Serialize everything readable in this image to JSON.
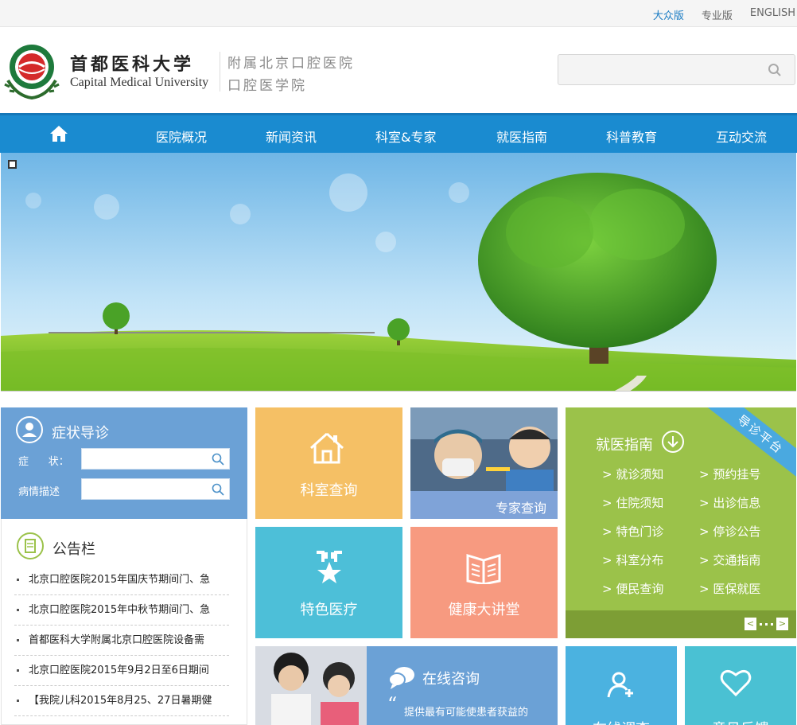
{
  "topbar": {
    "links": [
      "大众版",
      "专业版",
      "ENGLISH"
    ],
    "active_color": "#1a7cc4"
  },
  "header": {
    "brand_cn": "首都医科大学",
    "brand_en": "Capital Medical University",
    "sub_line1": "附属北京口腔医院",
    "sub_line2": "口腔医学院",
    "search_placeholder": ""
  },
  "nav": {
    "home_icon": "home-icon",
    "items": [
      "医院概况",
      "新闻资讯",
      "科室&专家",
      "就医指南",
      "科普教育",
      "互动交流"
    ],
    "color": "#1a8bd0"
  },
  "symptom": {
    "title": "症状导诊",
    "field1_label": "症      状：",
    "field2_label": "病情描述"
  },
  "notice": {
    "title": "公告栏",
    "items": [
      "北京口腔医院2015年国庆节期间门、急",
      "北京口腔医院2015年中秋节期间门、急",
      "首都医科大学附属北京口腔医院设备需",
      "北京口腔医院2015年9月2日至6日期间",
      "【我院儿科2015年8月25、27日暑期健"
    ]
  },
  "tiles": {
    "dept": "科室查询",
    "expert": "专家查询",
    "special": "特色医疗",
    "lecture": "健康大讲堂",
    "consult_title": "在线咨询",
    "consult_desc": "提供最有可能使患者获益的",
    "survey": "在线调查",
    "feedback": "意见反馈"
  },
  "guide": {
    "title": "就医指南",
    "ribbon": "导诊平台",
    "links": [
      "> 就诊须知",
      "> 预约挂号",
      "> 住院须知",
      "> 出诊信息",
      "> 特色门诊",
      "> 停诊公告",
      "> 科室分布",
      "> 交通指南",
      "> 便民查询",
      "> 医保就医"
    ],
    "prev": "<",
    "next": ">"
  }
}
